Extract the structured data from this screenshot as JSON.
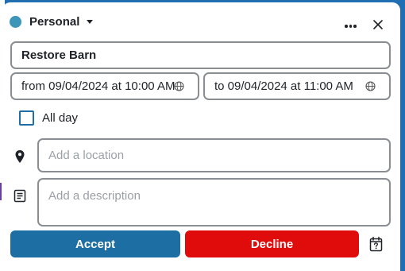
{
  "header": {
    "calendar_name": "Personal",
    "calendar_color": "#3d96b8"
  },
  "event": {
    "title": "Restore Barn",
    "from": "from 09/04/2024 at 10:00 AM",
    "to": "to 09/04/2024 at 11:00 AM",
    "all_day_label": "All day",
    "all_day_checked": false
  },
  "location": {
    "placeholder": "Add a location",
    "value": ""
  },
  "description": {
    "placeholder": "Add a description",
    "value": ""
  },
  "actions": {
    "accept_label": "Accept",
    "decline_label": "Decline",
    "accept_color": "#1d6ea3",
    "decline_color": "#e00b0b"
  },
  "icons": {
    "more": "more-horizontal-icon",
    "close": "close-icon",
    "timezone": "globe-icon",
    "location": "map-pin-icon",
    "description": "notes-icon",
    "calendar_tentative": "calendar-question-icon"
  }
}
